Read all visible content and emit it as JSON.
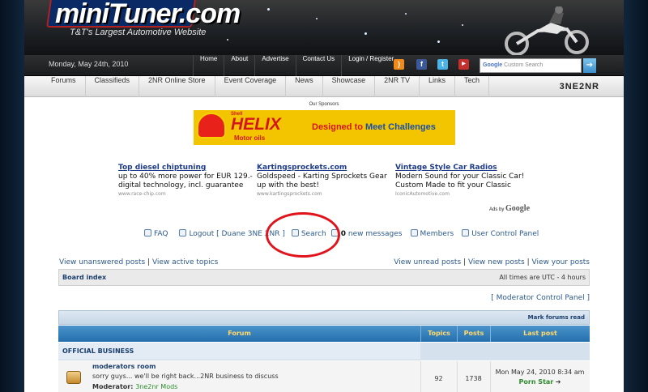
{
  "header": {
    "logo_text": "miniTuner.com",
    "tagline": "T&T's Largest Automotive Website"
  },
  "topbar": {
    "date": "Monday, May 24th, 2010",
    "links": [
      "Home",
      "About",
      "Advertise",
      "Contact Us",
      "Login / Register"
    ],
    "search_placeholder": "Custom Search",
    "search_brand": "Google"
  },
  "subnav": {
    "links": [
      "Forums",
      "Classifieds",
      "2NR Online Store",
      "Event Coverage",
      "News",
      "Showcase",
      "2NR TV",
      "Links",
      "Tech"
    ],
    "logo": "3NE2NR"
  },
  "sponsors": {
    "label": "Our Sponsors",
    "banner": {
      "brand": "Shell",
      "product": "HELIX",
      "sub": "Motor oils",
      "tagline_a": "Designed to",
      "tagline_b": "Meet Challenges"
    }
  },
  "ads": [
    {
      "title": "Top diesel chiptuning",
      "body": "up to 40% more power for EUR 129.- digital technology, incl. guarantee",
      "url": "www.race-chip.com"
    },
    {
      "title": "Kartingsprockets.com",
      "body": "Goldspeed - Karting Sprockets Gear up with the best!",
      "url": "www.kartingsprockets.com"
    },
    {
      "title": "Vintage Style Car Radios",
      "body": "Modern Sound for your Classic Car! Custom Made to fit your Classic",
      "url": "IconicAutomotive.com"
    }
  ],
  "ads_by": {
    "label": "Ads by",
    "brand": "Google"
  },
  "forum_links": {
    "faq": "FAQ",
    "logout": "Logout [ Duane 3NE 2NR ]",
    "search": "Search",
    "msg_count": "0",
    "messages": "new messages",
    "members": "Members",
    "ucp": "User Control Panel"
  },
  "quick_left": [
    "View unanswered posts",
    "View active topics"
  ],
  "quick_right": [
    "View unread posts",
    "View new posts",
    "View your posts"
  ],
  "sep": "|",
  "board_bar": {
    "index": "Board index",
    "times": "All times are UTC - 4 hours"
  },
  "modcp": "[ Moderator Control Panel ]",
  "mark_read": "Mark forums read",
  "table": {
    "headers": [
      "Forum",
      "Topics",
      "Posts",
      "Last post"
    ],
    "category": "OFFICIAL BUSINESS",
    "rows": [
      {
        "name": "moderators room",
        "desc": "sorry guys... we'll be right back...2NR business to discuss",
        "mod_label": "Moderator:",
        "mod": "3ne2nr Mods",
        "topics": "92",
        "posts": "1738",
        "last_date": "Mon May 24, 2010 8:34 am",
        "last_user": "Porn Star"
      }
    ]
  },
  "colors": {
    "accent": "#2470ad",
    "link": "#2c5a8c",
    "highlight": "#e0141c"
  }
}
